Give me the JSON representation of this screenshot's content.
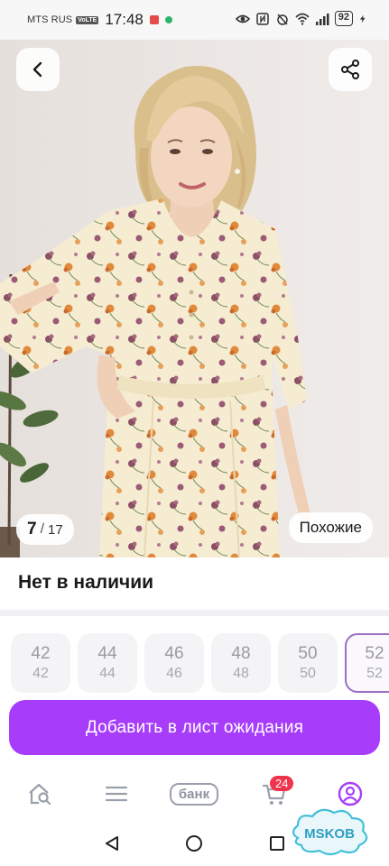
{
  "status_bar": {
    "carrier": "MTS RUS",
    "volte": "VoLTE",
    "time": "17:48",
    "battery": "92"
  },
  "gallery": {
    "current": "7",
    "separator": "/",
    "total": "17",
    "similar_label": "Похожие"
  },
  "availability": "Нет в наличии",
  "sizes": [
    {
      "a": "42",
      "b": "42"
    },
    {
      "a": "44",
      "b": "44"
    },
    {
      "a": "46",
      "b": "46"
    },
    {
      "a": "48",
      "b": "48"
    },
    {
      "a": "50",
      "b": "50"
    },
    {
      "a": "52",
      "b": "52"
    }
  ],
  "add_button_label": "Добавить в лист ожидания",
  "bottom_nav": {
    "bank_label": "банк",
    "cart_count": "24"
  },
  "watermark": "MSKOB",
  "colors": {
    "accent": "#a73dfa",
    "badge": "#f0334d",
    "selected_border": "#9b6fc2"
  }
}
